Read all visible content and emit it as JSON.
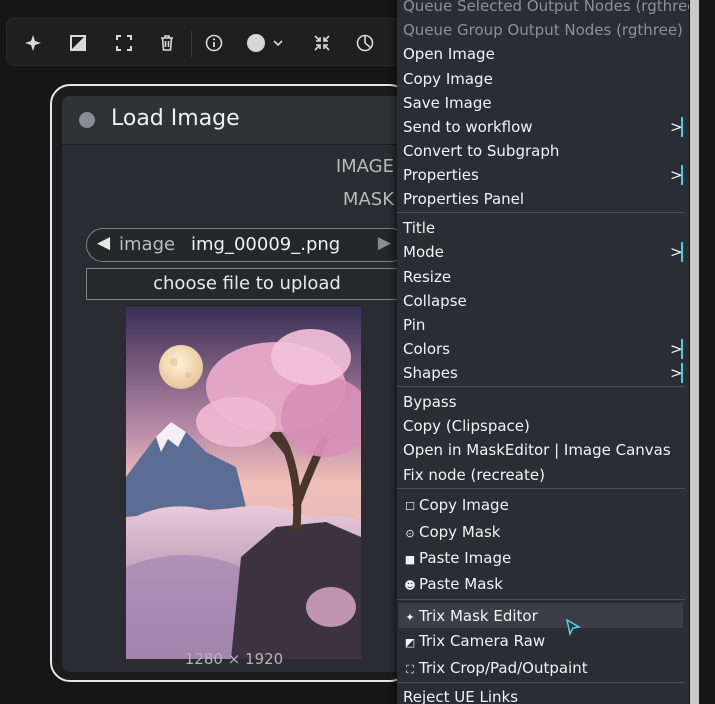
{
  "toolbar": {
    "icons": [
      "sparkle-icon",
      "contrast-icon",
      "crop-icon",
      "trash-icon",
      "info-icon",
      "color-dot-icon",
      "collapse-icon",
      "pie-icon"
    ],
    "color_chevron": "⌄"
  },
  "node": {
    "title": "Load Image",
    "outputs": [
      "IMAGE",
      "MASK"
    ],
    "combo": {
      "name": "image",
      "value": "img_00009_.png",
      "left_arrow": "◀",
      "right_arrow": "▶"
    },
    "upload_label": "choose file to upload",
    "dimensions": "1280 × 1920"
  },
  "menu": {
    "items": [
      {
        "label": "Queue Selected Output Nodes (rgthree)",
        "disabled": true
      },
      {
        "label": "Queue Group Output Nodes (rgthree)",
        "disabled": true
      },
      {
        "label": "Open Image"
      },
      {
        "label": "Copy Image"
      },
      {
        "label": "Save Image"
      },
      {
        "label": "Send to workflow",
        "submenu": true
      },
      {
        "label": "Convert to Subgraph"
      },
      {
        "label": "Properties",
        "submenu": true
      },
      {
        "label": "Properties Panel"
      },
      {
        "label": "Title"
      },
      {
        "label": "Mode",
        "submenu": true
      },
      {
        "label": "Resize"
      },
      {
        "label": "Collapse"
      },
      {
        "label": "Pin"
      },
      {
        "label": "Colors",
        "submenu": true
      },
      {
        "label": "Shapes",
        "submenu": true
      },
      {
        "label": "Bypass"
      },
      {
        "label": "Copy (Clipspace)"
      },
      {
        "label": "Open in MaskEditor | Image Canvas"
      },
      {
        "label": "Fix node (recreate)"
      },
      {
        "label": "Copy Image",
        "icon": "☐"
      },
      {
        "label": "Copy Mask",
        "icon": "⊙"
      },
      {
        "label": "Paste Image",
        "icon": "■"
      },
      {
        "label": "Paste Mask",
        "icon": "☻"
      },
      {
        "label": "Trix Mask Editor",
        "icon": "✦",
        "highlighted": true
      },
      {
        "label": "Trix Camera Raw",
        "icon": "◩"
      },
      {
        "label": "Trix Crop/Pad/Outpaint",
        "icon": "⛶"
      },
      {
        "label": "Reject UE Links"
      }
    ],
    "submenu_arrow": ">"
  },
  "colors": {
    "accent_bar": "#3fd0f0",
    "menu_bg": "#2a2d33"
  }
}
